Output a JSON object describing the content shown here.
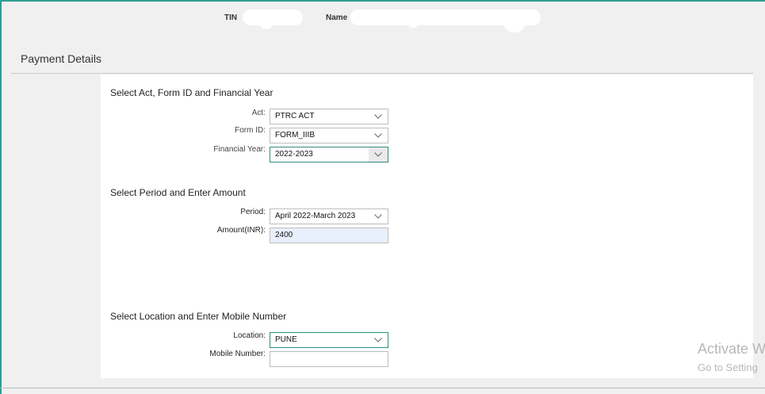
{
  "header": {
    "tin_label": "TIN",
    "name_label": "Name"
  },
  "page": {
    "section_title": "Payment Details"
  },
  "groups": {
    "act_form_year": {
      "title": "Select Act, Form ID and Financial Year",
      "act_label": "Act:",
      "act_value": "PTRC ACT",
      "form_id_label": "Form ID:",
      "form_id_value": "FORM_IIIB",
      "financial_year_label": "Financial Year:",
      "financial_year_value": "2022-2023"
    },
    "period_amount": {
      "title": "Select Period and Enter Amount",
      "period_label": "Period:",
      "period_value": "April 2022-March 2023",
      "amount_label": "Amount(INR):",
      "amount_value": "2400"
    },
    "location_mobile": {
      "title": "Select Location and Enter Mobile Number",
      "location_label": "Location:",
      "location_value": "PUNE",
      "mobile_label": "Mobile Number:",
      "mobile_value": ""
    }
  },
  "watermark": {
    "line1": "Activate W",
    "line2": "Go to Setting"
  },
  "colors": {
    "frame_accent": "#2f9c93",
    "focus_border": "#2f8d7e",
    "autofill_bg": "#e8f0fe",
    "page_bg": "#f0f0f0",
    "panel_bg": "#ffffff"
  }
}
